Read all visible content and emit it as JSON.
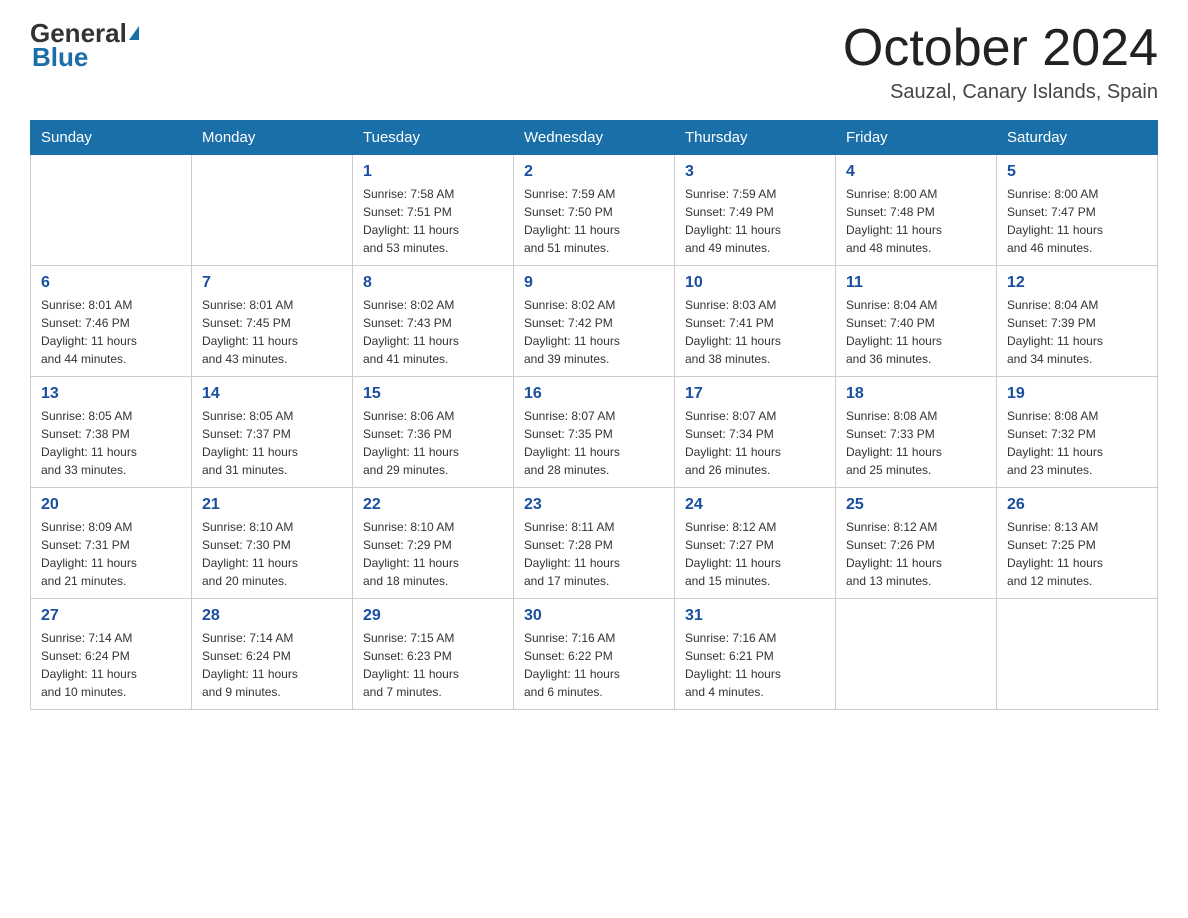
{
  "header": {
    "logo_general": "General",
    "logo_blue": "Blue",
    "month_title": "October 2024",
    "location": "Sauzal, Canary Islands, Spain"
  },
  "weekdays": [
    "Sunday",
    "Monday",
    "Tuesday",
    "Wednesday",
    "Thursday",
    "Friday",
    "Saturday"
  ],
  "weeks": [
    [
      {
        "day": "",
        "info": ""
      },
      {
        "day": "",
        "info": ""
      },
      {
        "day": "1",
        "info": "Sunrise: 7:58 AM\nSunset: 7:51 PM\nDaylight: 11 hours\nand 53 minutes."
      },
      {
        "day": "2",
        "info": "Sunrise: 7:59 AM\nSunset: 7:50 PM\nDaylight: 11 hours\nand 51 minutes."
      },
      {
        "day": "3",
        "info": "Sunrise: 7:59 AM\nSunset: 7:49 PM\nDaylight: 11 hours\nand 49 minutes."
      },
      {
        "day": "4",
        "info": "Sunrise: 8:00 AM\nSunset: 7:48 PM\nDaylight: 11 hours\nand 48 minutes."
      },
      {
        "day": "5",
        "info": "Sunrise: 8:00 AM\nSunset: 7:47 PM\nDaylight: 11 hours\nand 46 minutes."
      }
    ],
    [
      {
        "day": "6",
        "info": "Sunrise: 8:01 AM\nSunset: 7:46 PM\nDaylight: 11 hours\nand 44 minutes."
      },
      {
        "day": "7",
        "info": "Sunrise: 8:01 AM\nSunset: 7:45 PM\nDaylight: 11 hours\nand 43 minutes."
      },
      {
        "day": "8",
        "info": "Sunrise: 8:02 AM\nSunset: 7:43 PM\nDaylight: 11 hours\nand 41 minutes."
      },
      {
        "day": "9",
        "info": "Sunrise: 8:02 AM\nSunset: 7:42 PM\nDaylight: 11 hours\nand 39 minutes."
      },
      {
        "day": "10",
        "info": "Sunrise: 8:03 AM\nSunset: 7:41 PM\nDaylight: 11 hours\nand 38 minutes."
      },
      {
        "day": "11",
        "info": "Sunrise: 8:04 AM\nSunset: 7:40 PM\nDaylight: 11 hours\nand 36 minutes."
      },
      {
        "day": "12",
        "info": "Sunrise: 8:04 AM\nSunset: 7:39 PM\nDaylight: 11 hours\nand 34 minutes."
      }
    ],
    [
      {
        "day": "13",
        "info": "Sunrise: 8:05 AM\nSunset: 7:38 PM\nDaylight: 11 hours\nand 33 minutes."
      },
      {
        "day": "14",
        "info": "Sunrise: 8:05 AM\nSunset: 7:37 PM\nDaylight: 11 hours\nand 31 minutes."
      },
      {
        "day": "15",
        "info": "Sunrise: 8:06 AM\nSunset: 7:36 PM\nDaylight: 11 hours\nand 29 minutes."
      },
      {
        "day": "16",
        "info": "Sunrise: 8:07 AM\nSunset: 7:35 PM\nDaylight: 11 hours\nand 28 minutes."
      },
      {
        "day": "17",
        "info": "Sunrise: 8:07 AM\nSunset: 7:34 PM\nDaylight: 11 hours\nand 26 minutes."
      },
      {
        "day": "18",
        "info": "Sunrise: 8:08 AM\nSunset: 7:33 PM\nDaylight: 11 hours\nand 25 minutes."
      },
      {
        "day": "19",
        "info": "Sunrise: 8:08 AM\nSunset: 7:32 PM\nDaylight: 11 hours\nand 23 minutes."
      }
    ],
    [
      {
        "day": "20",
        "info": "Sunrise: 8:09 AM\nSunset: 7:31 PM\nDaylight: 11 hours\nand 21 minutes."
      },
      {
        "day": "21",
        "info": "Sunrise: 8:10 AM\nSunset: 7:30 PM\nDaylight: 11 hours\nand 20 minutes."
      },
      {
        "day": "22",
        "info": "Sunrise: 8:10 AM\nSunset: 7:29 PM\nDaylight: 11 hours\nand 18 minutes."
      },
      {
        "day": "23",
        "info": "Sunrise: 8:11 AM\nSunset: 7:28 PM\nDaylight: 11 hours\nand 17 minutes."
      },
      {
        "day": "24",
        "info": "Sunrise: 8:12 AM\nSunset: 7:27 PM\nDaylight: 11 hours\nand 15 minutes."
      },
      {
        "day": "25",
        "info": "Sunrise: 8:12 AM\nSunset: 7:26 PM\nDaylight: 11 hours\nand 13 minutes."
      },
      {
        "day": "26",
        "info": "Sunrise: 8:13 AM\nSunset: 7:25 PM\nDaylight: 11 hours\nand 12 minutes."
      }
    ],
    [
      {
        "day": "27",
        "info": "Sunrise: 7:14 AM\nSunset: 6:24 PM\nDaylight: 11 hours\nand 10 minutes."
      },
      {
        "day": "28",
        "info": "Sunrise: 7:14 AM\nSunset: 6:24 PM\nDaylight: 11 hours\nand 9 minutes."
      },
      {
        "day": "29",
        "info": "Sunrise: 7:15 AM\nSunset: 6:23 PM\nDaylight: 11 hours\nand 7 minutes."
      },
      {
        "day": "30",
        "info": "Sunrise: 7:16 AM\nSunset: 6:22 PM\nDaylight: 11 hours\nand 6 minutes."
      },
      {
        "day": "31",
        "info": "Sunrise: 7:16 AM\nSunset: 6:21 PM\nDaylight: 11 hours\nand 4 minutes."
      },
      {
        "day": "",
        "info": ""
      },
      {
        "day": "",
        "info": ""
      }
    ]
  ]
}
